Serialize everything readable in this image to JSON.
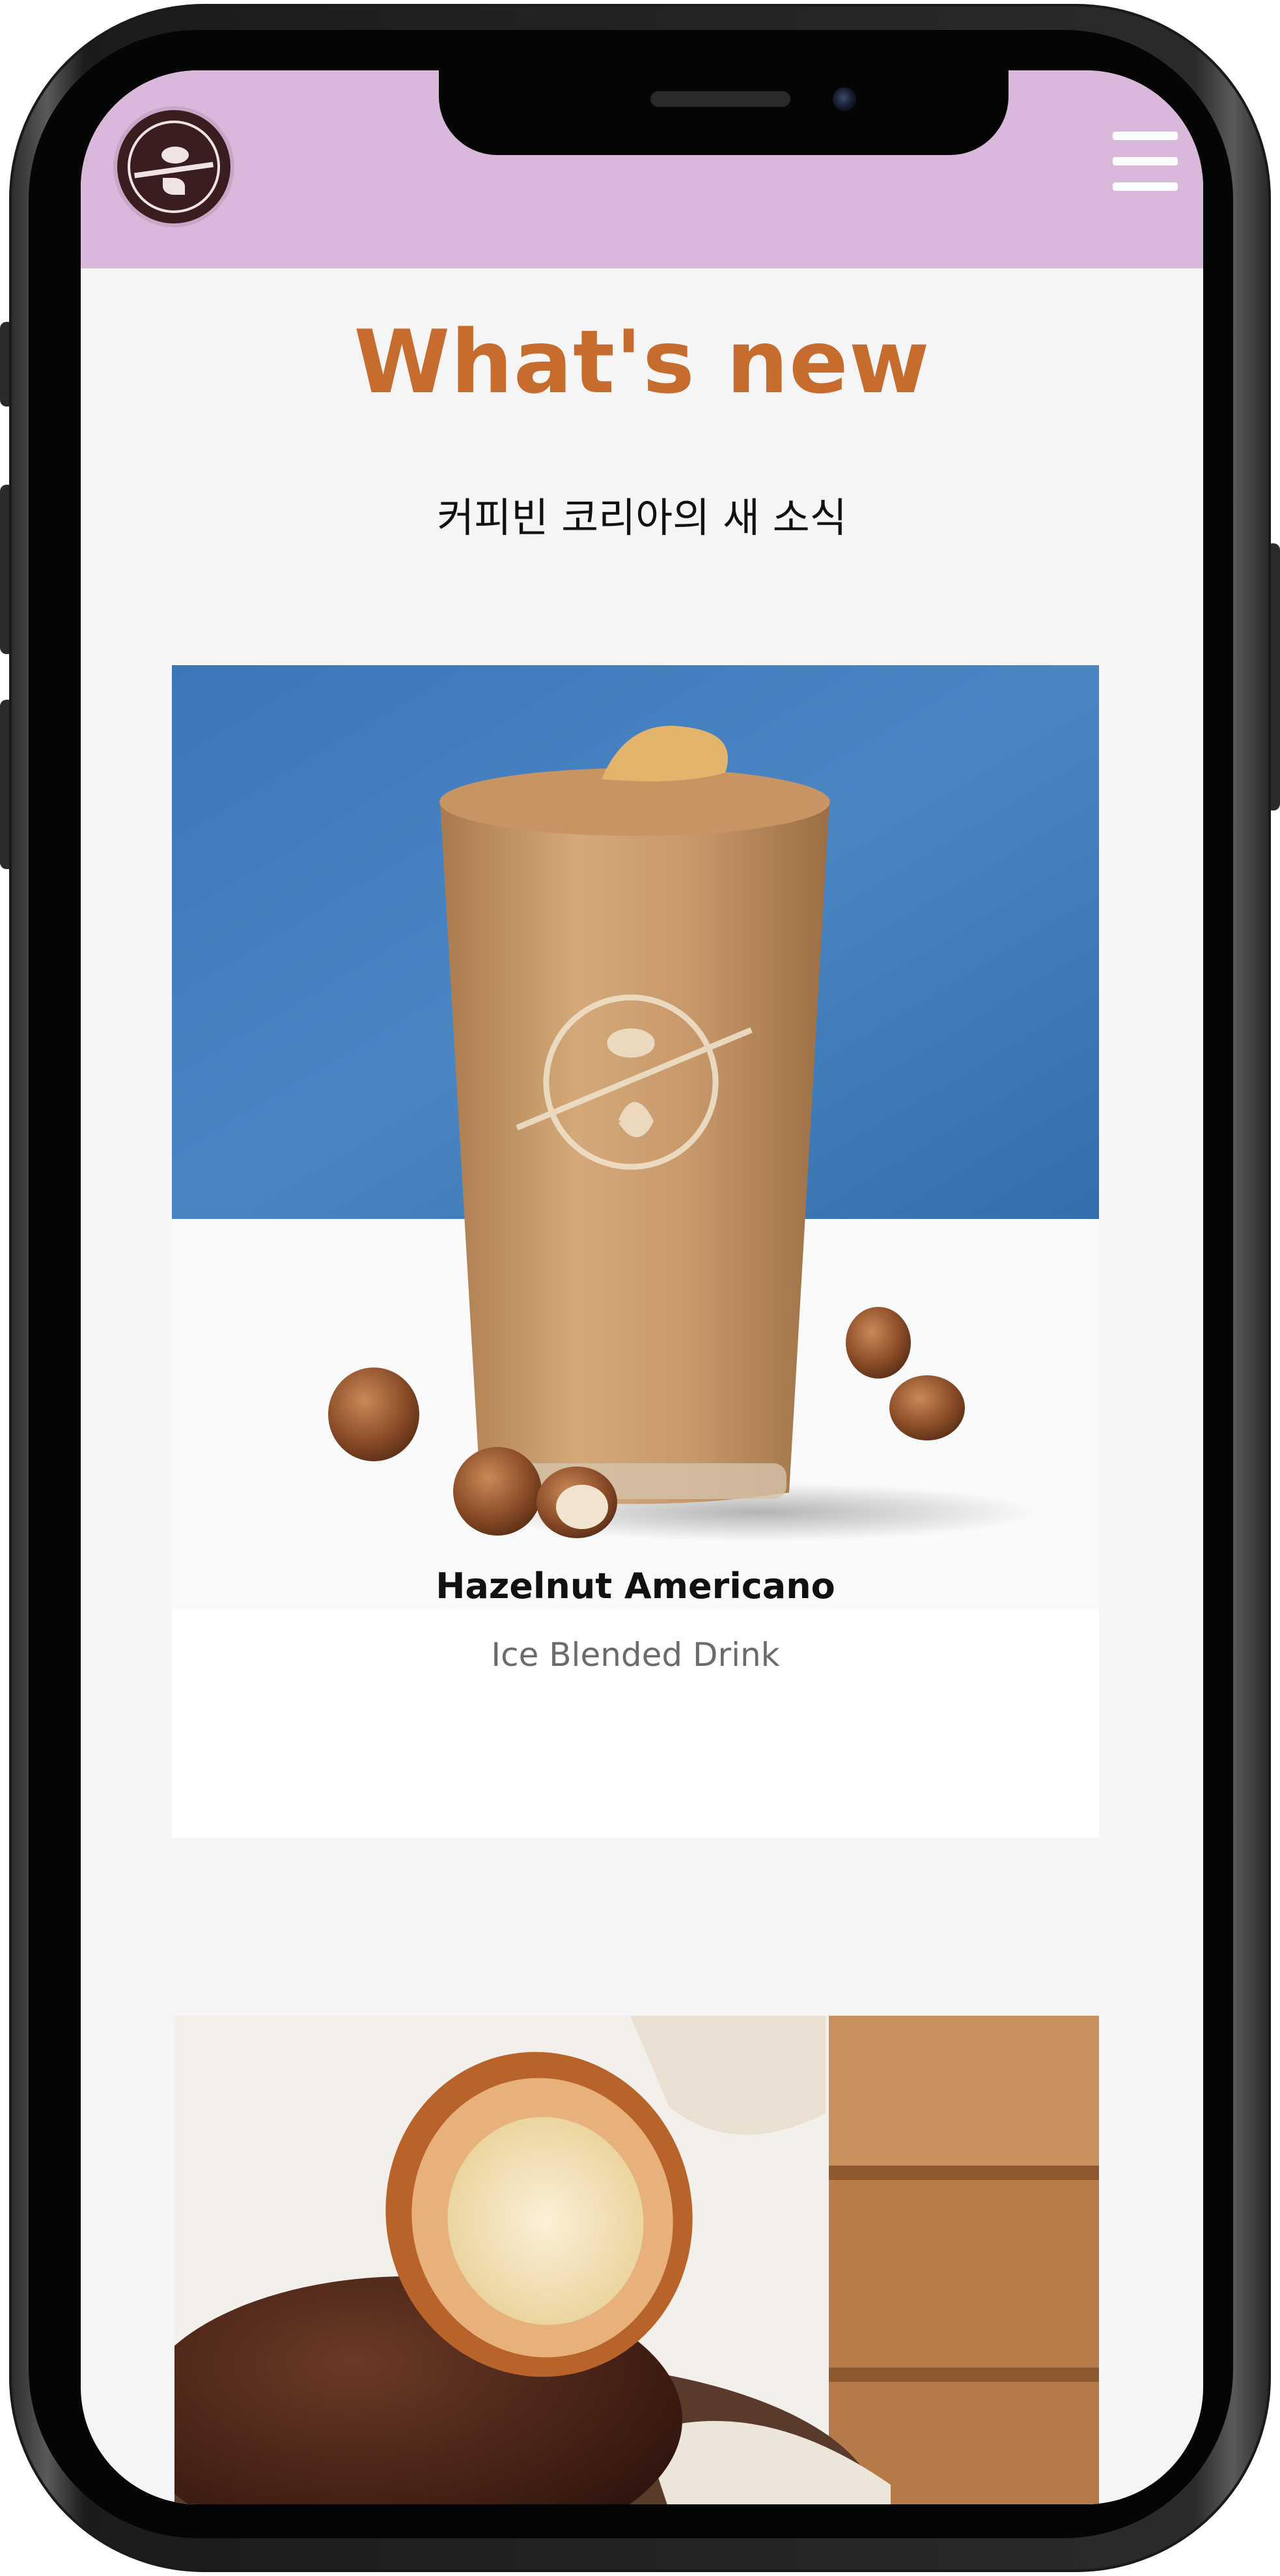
{
  "header": {
    "logo_icon": "coffee-bean-tea-leaf-logo",
    "menu_icon": "hamburger-menu-icon",
    "background_color": "#d9b8dc"
  },
  "main": {
    "title": "What's new",
    "subtitle": "커피빈 코리아의 새 소식",
    "title_color": "#c66c2f"
  },
  "cards": [
    {
      "name": "Hazelnut Americano",
      "category": "Ice Blended Drink",
      "image": "hazelnut-americano-drink-photo"
    },
    {
      "image": "chocolate-croissant-photo"
    }
  ]
}
